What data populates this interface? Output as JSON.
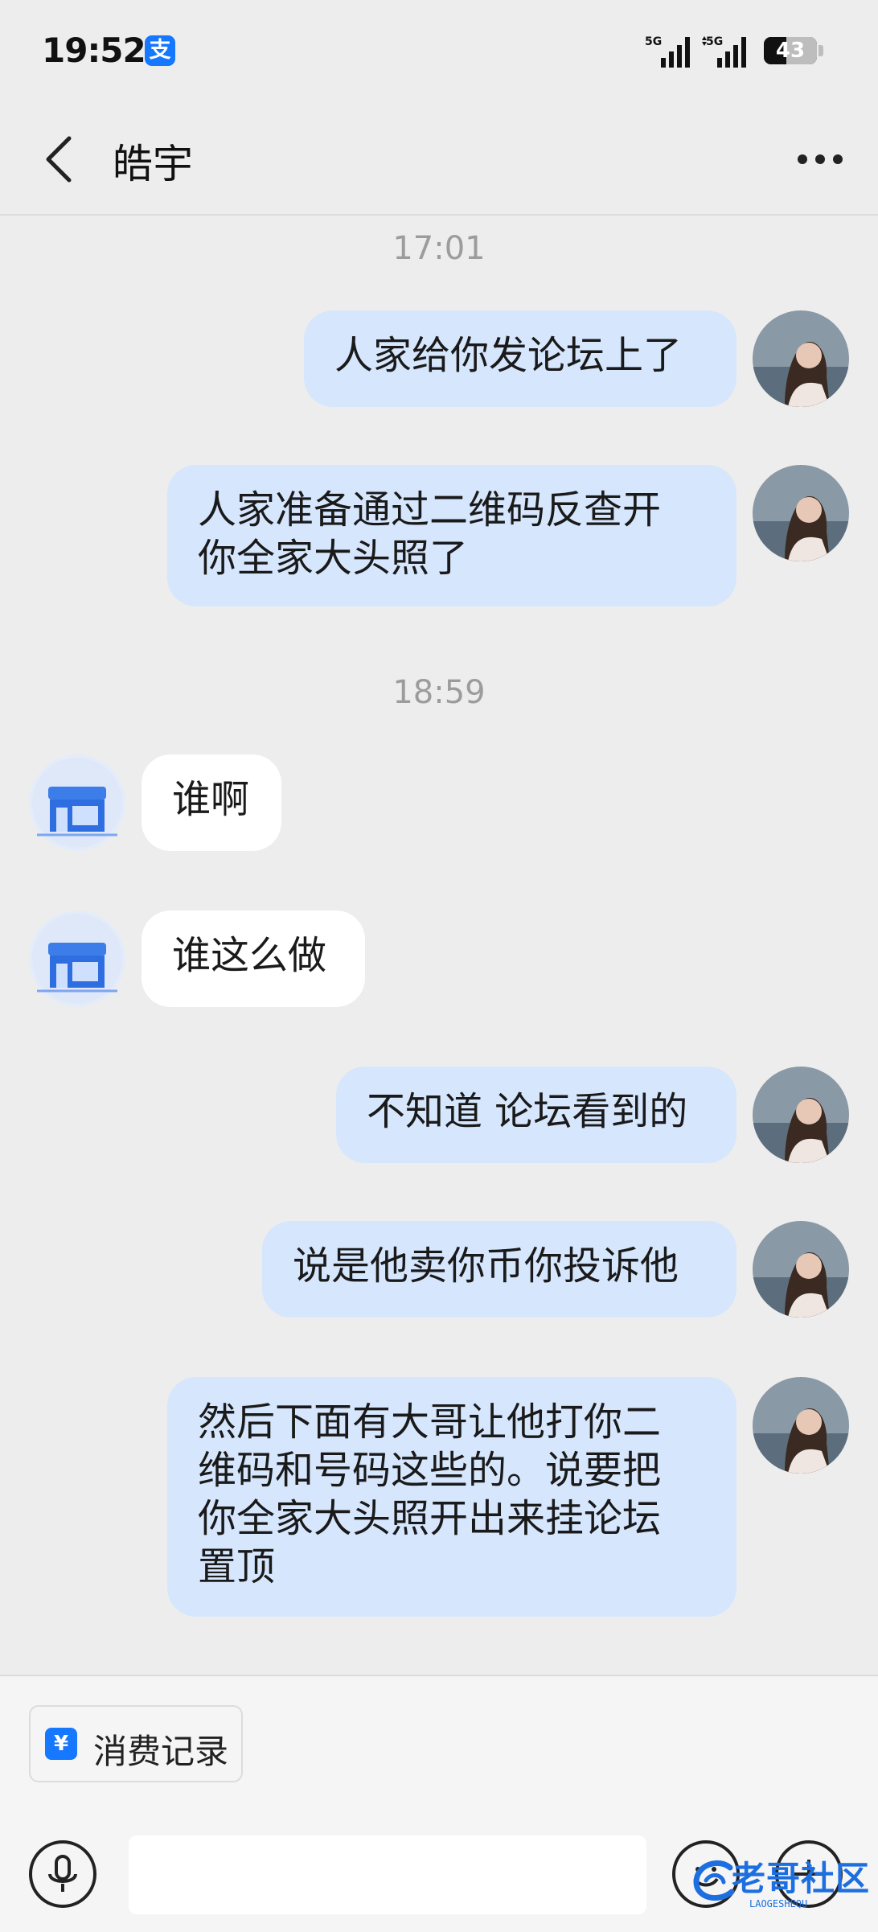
{
  "status_bar": {
    "time": "19:52",
    "app_badge": "支",
    "signal_1_label": "5G",
    "signal_2_label": "5G",
    "battery_level": "43"
  },
  "header": {
    "title": "皓宇",
    "back_icon": "chevron-left-icon",
    "more_icon": "more-horizontal-icon"
  },
  "messages": [
    {
      "kind": "time",
      "text": "17:01"
    },
    {
      "kind": "outgoing",
      "text": "人家给你发论坛上了"
    },
    {
      "kind": "outgoing",
      "text": "人家准备通过二维码反查开\n你全家大头照了"
    },
    {
      "kind": "time",
      "text": "18:59"
    },
    {
      "kind": "incoming",
      "text": "谁啊"
    },
    {
      "kind": "incoming",
      "text": "谁这么做"
    },
    {
      "kind": "outgoing",
      "text": "不知道 论坛看到的"
    },
    {
      "kind": "outgoing",
      "text": "说是他卖你币你投诉他"
    },
    {
      "kind": "outgoing",
      "text": "然后下面有大哥让他打你二\n维码和号码这些的。说要把\n你全家大头照开出来挂论坛\n置顶"
    }
  ],
  "bottom": {
    "quick_action_label": "消费记录",
    "quick_action_icon_glyph": "¥",
    "input_value": "",
    "mic_icon": "microphone-icon",
    "emoji_icon": "emoji-icon",
    "plus_icon": "plus-icon"
  },
  "watermark": {
    "text": "老哥社区",
    "subtext": "LAOGESHEQU"
  },
  "colors": {
    "background": "#ededed",
    "outgoing_bubble": "#d6e6fd",
    "incoming_bubble": "#ffffff",
    "accent": "#1677ff"
  }
}
